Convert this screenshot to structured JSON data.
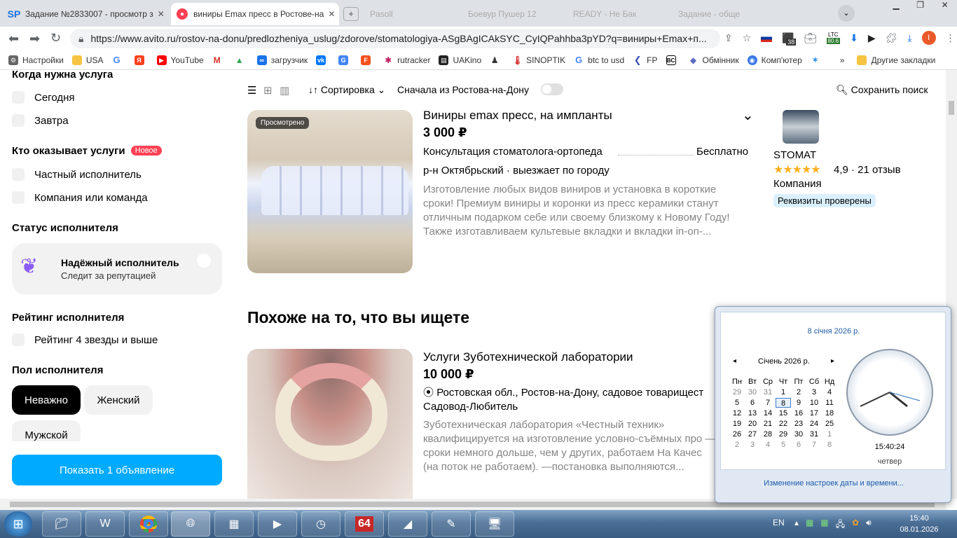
{
  "browser": {
    "tabs": [
      {
        "icon": "sp-icon",
        "label": "Задание №2833007 - просмотр з",
        "active": false
      },
      {
        "icon": "avito-icon",
        "label": "виниры Emax пресс в Ростове-на",
        "active": true
      },
      {
        "icon": "",
        "label": "Pasoll",
        "active": false
      },
      {
        "icon": "",
        "label": "Боевур Пушер 12",
        "active": false
      },
      {
        "icon": "",
        "label": "READY - Не Бак",
        "active": false
      },
      {
        "icon": "",
        "label": "Задание - обще",
        "active": false
      }
    ],
    "url": "https://www.avito.ru/rostov-na-donu/predlozheniya_uslug/zdorove/stomatologiya-ASgBAgICAkSYC_CyIQPahhba3pYD?q=виниры+Emax+п...",
    "ltc_badge": "LTC",
    "ltc_value": "80.6",
    "ext_badge": "38",
    "profile_initial": "I",
    "bookmarks": [
      "Настройки",
      "USA",
      "",
      "",
      "YouTube",
      "",
      "",
      "загрузчик",
      "",
      "",
      "",
      "rutracker",
      "UAKino",
      "",
      "SINOPTIK",
      "btc to usd",
      "FP",
      "",
      "Обмінник",
      "Комп'ютер",
      "»",
      "Другие закладки"
    ]
  },
  "filters": {
    "when_title": "Когда нужна услуга",
    "when_options": [
      "Сегодня",
      "Завтра"
    ],
    "who_title": "Кто оказывает услуги",
    "who_badge": "Новое",
    "who_options": [
      "Частный исполнитель",
      "Компания или команда"
    ],
    "status_title": "Статус исполнителя",
    "reliable_title": "Надёжный исполнитель",
    "reliable_sub": "Следит за репутацией",
    "rating_title": "Рейтинг исполнителя",
    "rating_option": "Рейтинг 4 звезды и выше",
    "gender_title": "Пол исполнителя",
    "gender_options": [
      "Неважно",
      "Женский",
      "Мужской"
    ],
    "show_button": "Показать 1 объявление"
  },
  "results_bar": {
    "sort_label": "Сортировка",
    "rostov_first": "Сначала из Ростова-на-Дону",
    "save_search": "Сохранить поиск"
  },
  "listing1": {
    "badge": "Просмотрено",
    "title": "Виниры emax пресс, на импланты",
    "price": "3 000 ₽",
    "service": "Консультация стоматолога-ортопеда",
    "service_price": "Бесплатно",
    "location": "р-н Октябрьский · выезжает по городу",
    "desc": "Изготовление любых видов виниров и установка в короткие сроки! Премиум виниры и коронки из пресс керамики станут отличным подарком себе или своему близкому к Новому Году! Также изготавливаем культевые вкладки и вкладки in-on-...",
    "seller_name": "STOMAT",
    "seller_stars": "★★★★★",
    "seller_rating": "4,9 · 21 отзыв",
    "seller_type": "Компания",
    "seller_badge": "Реквизиты проверены"
  },
  "similar_title": "Похоже на то, что вы ищете",
  "listing2": {
    "title": "Услуги Зуботехнической лаборатории",
    "price": "10 000 ₽",
    "location": "Ростовская обл., Ростов-на-Дону, садовое товарищест Садовод-Любитель",
    "desc": "Зуботехническая лаборатория «Честный техник» квалифицируется на изготовление условно-съёмных про —сроки немного дольше, чем у других, работаем На Качес (на поток не работаем). —постановка выполняются..."
  },
  "calendar": {
    "date_header": "8 січня 2026 р.",
    "month_label": "Січень 2026 р.",
    "weekdays": [
      "Пн",
      "Вт",
      "Ср",
      "Чт",
      "Пт",
      "Сб",
      "Нд"
    ],
    "days": [
      "29",
      "30",
      "31",
      "1",
      "2",
      "3",
      "4",
      "5",
      "6",
      "7",
      "8",
      "9",
      "10",
      "11",
      "12",
      "13",
      "14",
      "15",
      "16",
      "17",
      "18",
      "19",
      "20",
      "21",
      "22",
      "23",
      "24",
      "25",
      "26",
      "27",
      "28",
      "29",
      "30",
      "31",
      "1",
      "2",
      "3",
      "4",
      "5",
      "6",
      "7",
      "8"
    ],
    "time": "15:40:24",
    "weekday_name": "четвер",
    "settings_link": "Изменение настроек даты и времени..."
  },
  "taskbar": {
    "lang": "EN",
    "time": "15:40",
    "date": "08.01.2026",
    "app_64": "64"
  }
}
